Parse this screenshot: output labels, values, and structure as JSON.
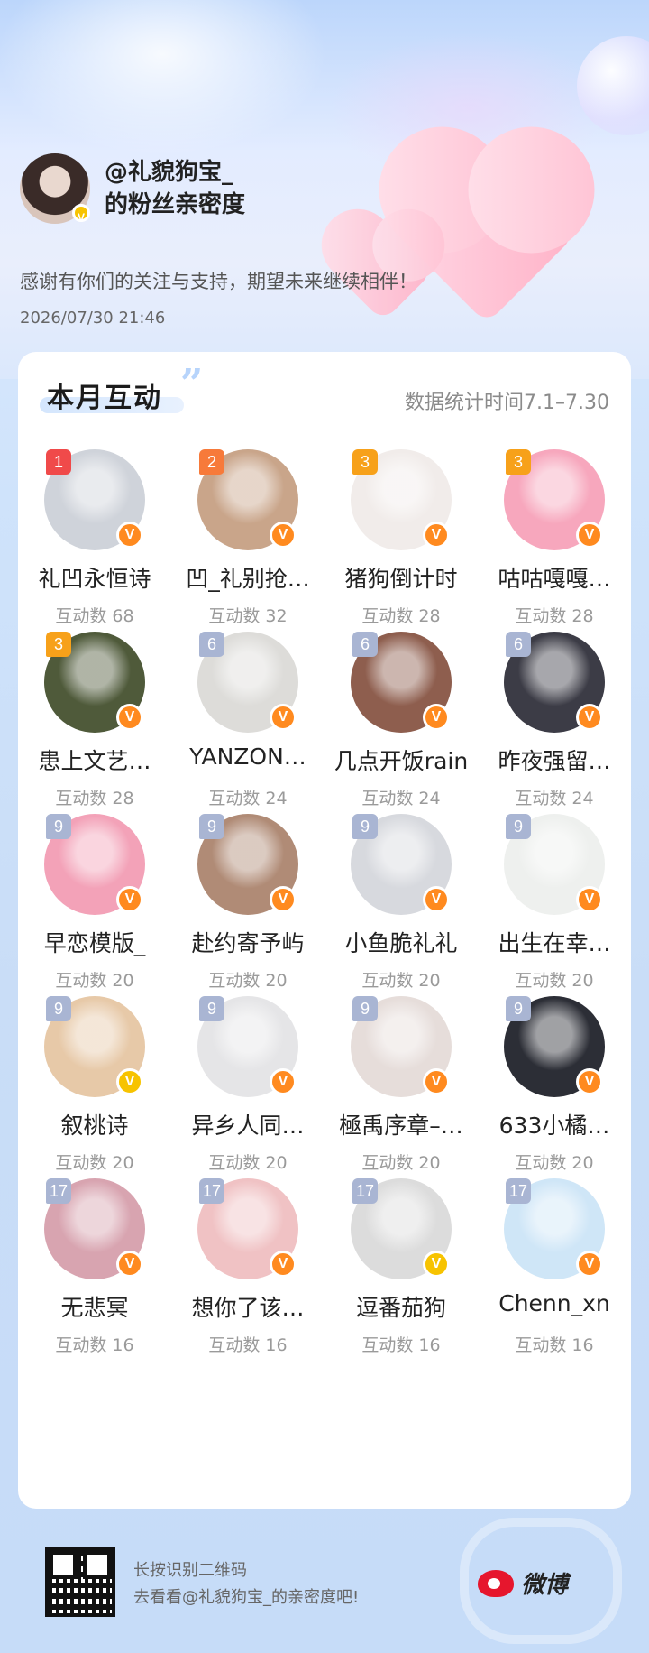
{
  "header": {
    "owner_name": "@礼貌狗宝_",
    "owner_sub": "的粉丝亲密度",
    "thanks": "感谢有你们的关注与支持，期望未来继续相伴！",
    "datetime": "2026/07/30 21:46"
  },
  "card": {
    "title": "本月互动",
    "period": "数据统计时间7.1–7.30"
  },
  "fans": [
    {
      "rank": "1",
      "name": "礼凹永恒诗",
      "count": "互动数 68",
      "color": "#cfd3da",
      "badge": "orange"
    },
    {
      "rank": "2",
      "name": "凹_礼别抢…",
      "count": "互动数 32",
      "color": "#c9a58a",
      "badge": "orange"
    },
    {
      "rank": "3",
      "name": "猪狗倒计时",
      "count": "互动数 28",
      "color": "#f1ecea",
      "badge": "orange"
    },
    {
      "rank": "3",
      "name": "咕咕嘎嘎…",
      "count": "互动数 28",
      "color": "#f7a7bd",
      "badge": "orange"
    },
    {
      "rank": "3",
      "name": "患上文艺…",
      "count": "互动数 28",
      "color": "#4f5a3a",
      "badge": "orange"
    },
    {
      "rank": "6",
      "name": "YANZON…",
      "count": "互动数 24",
      "color": "#dddcd9",
      "badge": "orange"
    },
    {
      "rank": "6",
      "name": "几点开饭rain",
      "count": "互动数 24",
      "color": "#8e5e4e",
      "badge": "orange"
    },
    {
      "rank": "6",
      "name": "昨夜强留…",
      "count": "互动数 24",
      "color": "#3c3c46",
      "badge": "orange"
    },
    {
      "rank": "9",
      "name": "早恋模版_",
      "count": "互动数 20",
      "color": "#f3a2b8",
      "badge": "orange"
    },
    {
      "rank": "9",
      "name": "赴约寄予屿",
      "count": "互动数 20",
      "color": "#b08b76",
      "badge": "orange"
    },
    {
      "rank": "9",
      "name": "小鱼脆礼礼",
      "count": "互动数 20",
      "color": "#d7d9de",
      "badge": "orange"
    },
    {
      "rank": "9",
      "name": "出生在幸…",
      "count": "互动数 20",
      "color": "#eef0ee",
      "badge": "orange"
    },
    {
      "rank": "9",
      "name": "叙桃诗",
      "count": "互动数 20",
      "color": "#e7c9a8",
      "badge": "gold"
    },
    {
      "rank": "9",
      "name": "异乡人同…",
      "count": "互动数 20",
      "color": "#e5e5e7",
      "badge": "orange"
    },
    {
      "rank": "9",
      "name": "極禹序章–…",
      "count": "互动数 20",
      "color": "#e6ddda",
      "badge": "orange"
    },
    {
      "rank": "9",
      "name": "633小橘…",
      "count": "互动数 20",
      "color": "#2c2e36",
      "badge": "orange"
    },
    {
      "rank": "17",
      "name": "无悲冥",
      "count": "互动数 16",
      "color": "#d8a4b0",
      "badge": "orange"
    },
    {
      "rank": "17",
      "name": "想你了该…",
      "count": "互动数 16",
      "color": "#f0c2c4",
      "badge": "orange"
    },
    {
      "rank": "17",
      "name": "逗番茄狗",
      "count": "互动数 16",
      "color": "#dcdcdc",
      "badge": "gold"
    },
    {
      "rank": "17",
      "name": "Chenn_xn",
      "count": "互动数 16",
      "color": "#cfe6f7",
      "badge": "orange"
    }
  ],
  "badge_label": "V",
  "footer": {
    "line1": "长按识别二维码",
    "line2": "去看看@礼貌狗宝_的亲密度吧!",
    "brand": "微博"
  }
}
